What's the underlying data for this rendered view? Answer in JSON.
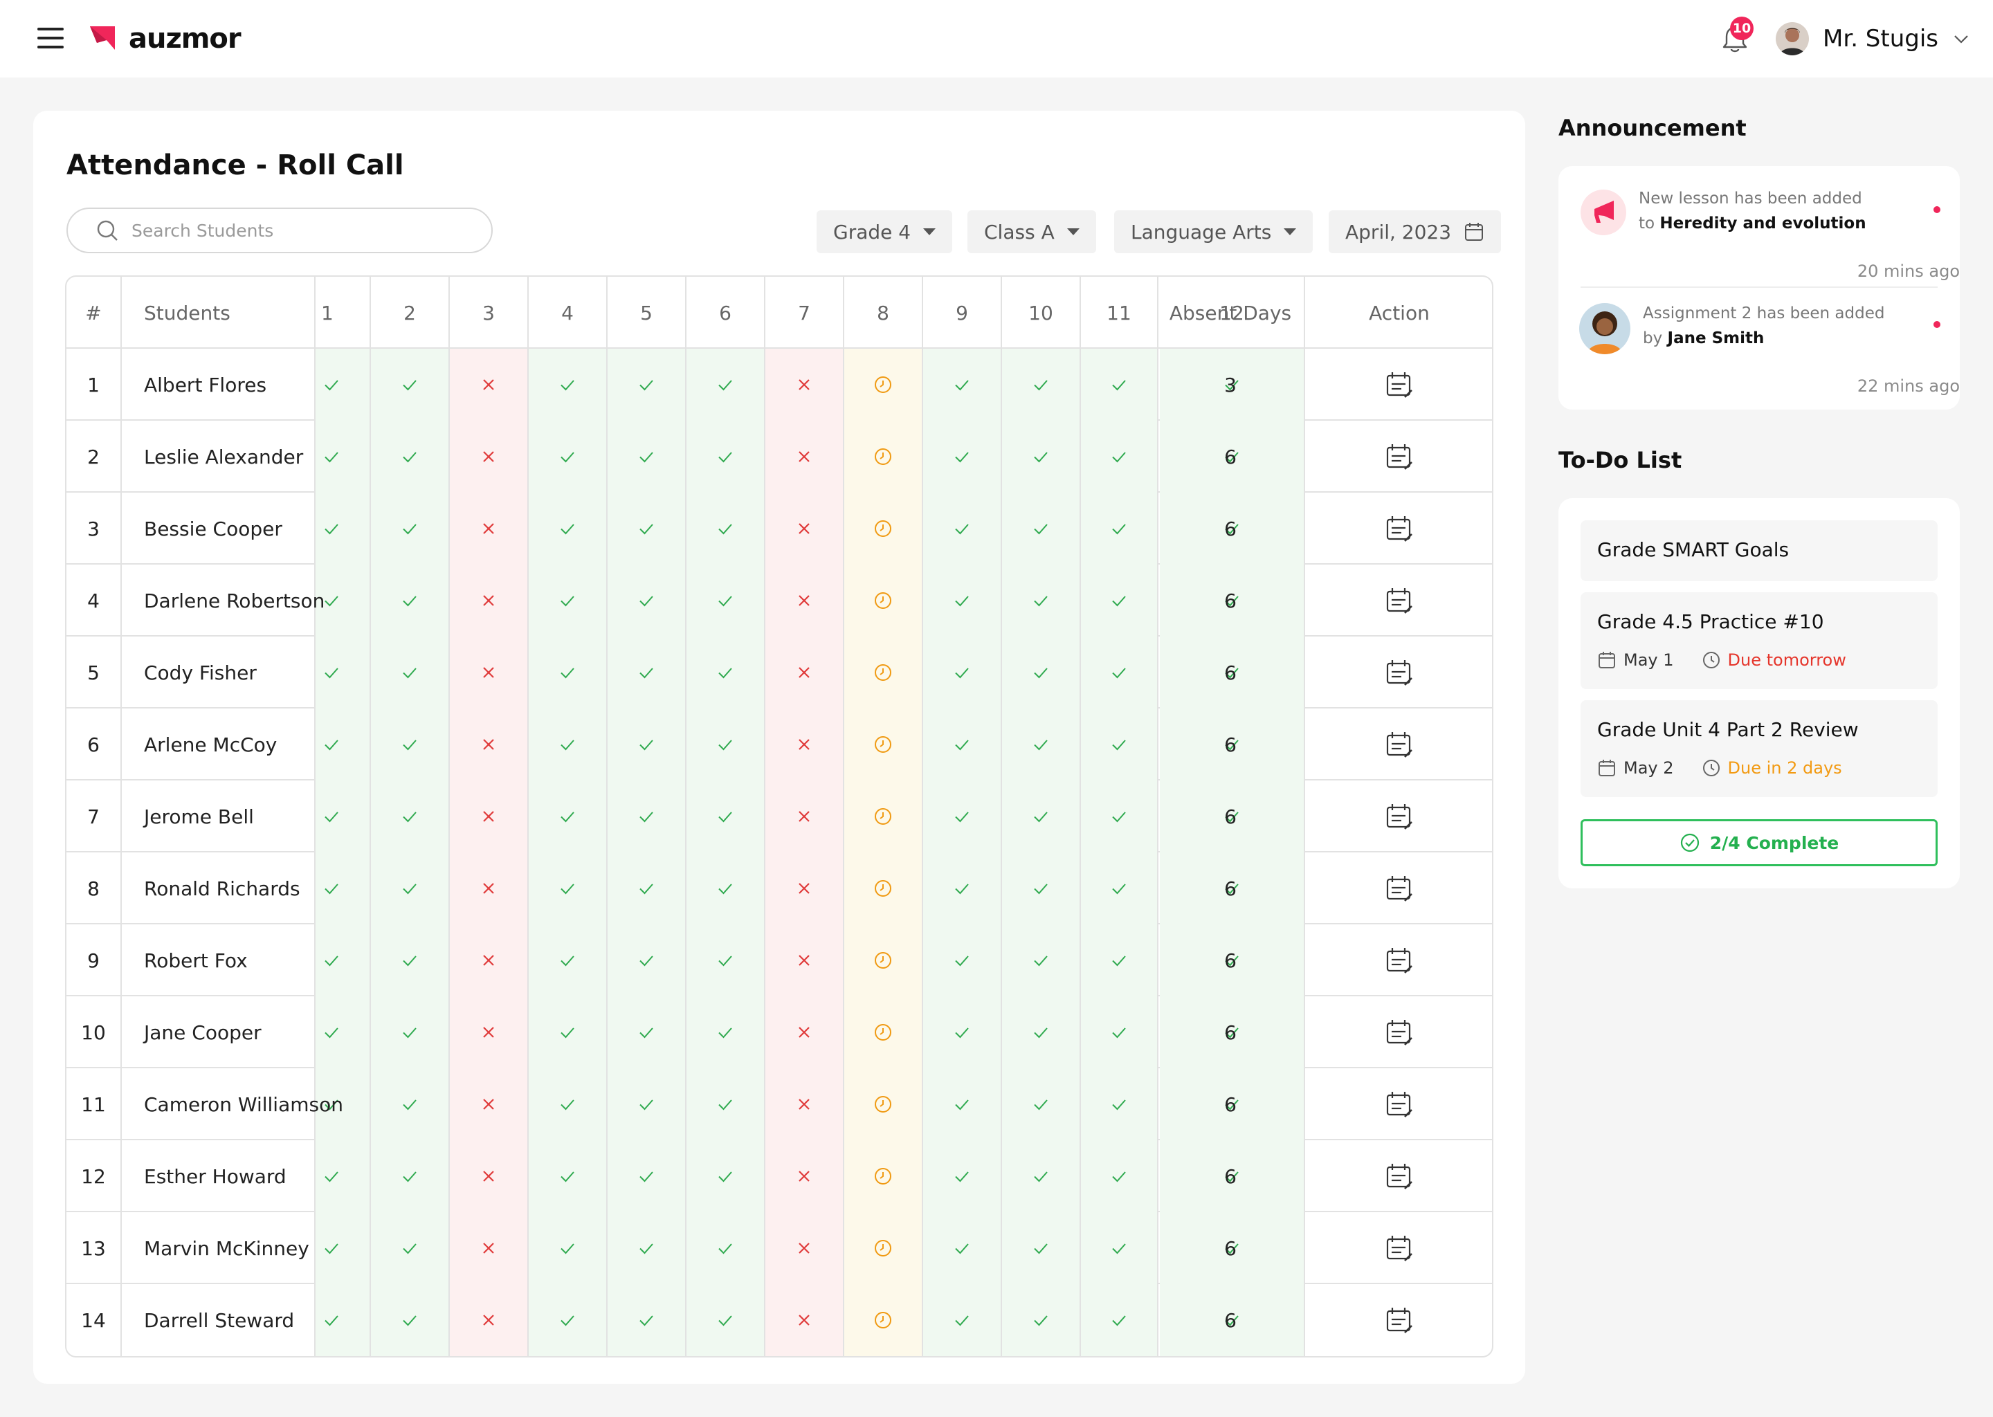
{
  "app": {
    "brand": "auzmor",
    "notifications_count": "10",
    "user_name": "Mr. Stugis"
  },
  "attendance": {
    "title": "Attendance - Roll Call",
    "search_placeholder": "Search Students",
    "filters": {
      "grade": "Grade 4",
      "class": "Class A",
      "subject": "Language Arts",
      "month": "April, 2023"
    },
    "columns": {
      "index": "#",
      "students": "Students",
      "days": [
        "1",
        "2",
        "3",
        "4",
        "5",
        "6",
        "7",
        "8",
        "9",
        "10",
        "11",
        "12"
      ],
      "absent": "Absent Days",
      "action": "Action"
    },
    "legend_status": {
      "present": "check-icon",
      "absent": "x-icon",
      "late": "clock-icon"
    },
    "day_status": [
      "present",
      "present",
      "absent",
      "present",
      "present",
      "present",
      "absent",
      "late",
      "present",
      "present",
      "present",
      "present"
    ],
    "rows": [
      {
        "num": "1",
        "name": "Albert Flores",
        "absent": "3"
      },
      {
        "num": "2",
        "name": "Leslie Alexander",
        "absent": "6"
      },
      {
        "num": "3",
        "name": "Bessie Cooper",
        "absent": "6"
      },
      {
        "num": "4",
        "name": "Darlene Robertson",
        "absent": "6"
      },
      {
        "num": "5",
        "name": "Cody Fisher",
        "absent": "6"
      },
      {
        "num": "6",
        "name": "Arlene McCoy",
        "absent": "6"
      },
      {
        "num": "7",
        "name": "Jerome Bell",
        "absent": "6"
      },
      {
        "num": "8",
        "name": "Ronald Richards",
        "absent": "6"
      },
      {
        "num": "9",
        "name": "Robert Fox",
        "absent": "6"
      },
      {
        "num": "10",
        "name": "Jane Cooper",
        "absent": "6"
      },
      {
        "num": "11",
        "name": "Cameron Williamson",
        "absent": "6"
      },
      {
        "num": "12",
        "name": "Esther Howard",
        "absent": "6"
      },
      {
        "num": "13",
        "name": "Marvin McKinney",
        "absent": "6"
      },
      {
        "num": "14",
        "name": "Darrell Steward",
        "absent": "6"
      }
    ]
  },
  "announcement": {
    "title": "Announcement",
    "items": [
      {
        "line1": "New lesson has been added",
        "prefix": "to",
        "bold": "Heredity and evolution",
        "time": "20 mins ago"
      },
      {
        "line1": "Assignment 2 has been added",
        "prefix": "by",
        "bold": "Jane Smith",
        "time": "22 mins ago"
      }
    ]
  },
  "todo": {
    "title": "To-Do List",
    "items": [
      {
        "title": "Grade SMART Goals"
      },
      {
        "title": "Grade 4.5 Practice #10",
        "date": "May 1",
        "due": "Due tomorrow"
      },
      {
        "title": "Grade Unit 4 Part 2 Review",
        "date": "May 2",
        "due": "Due in 2 days"
      }
    ],
    "complete_label": "2/4 Complete"
  },
  "colors": {
    "brand": "#f0265a",
    "present": "#2faa4f",
    "absent": "#e03a3a",
    "late": "#f09a12"
  }
}
